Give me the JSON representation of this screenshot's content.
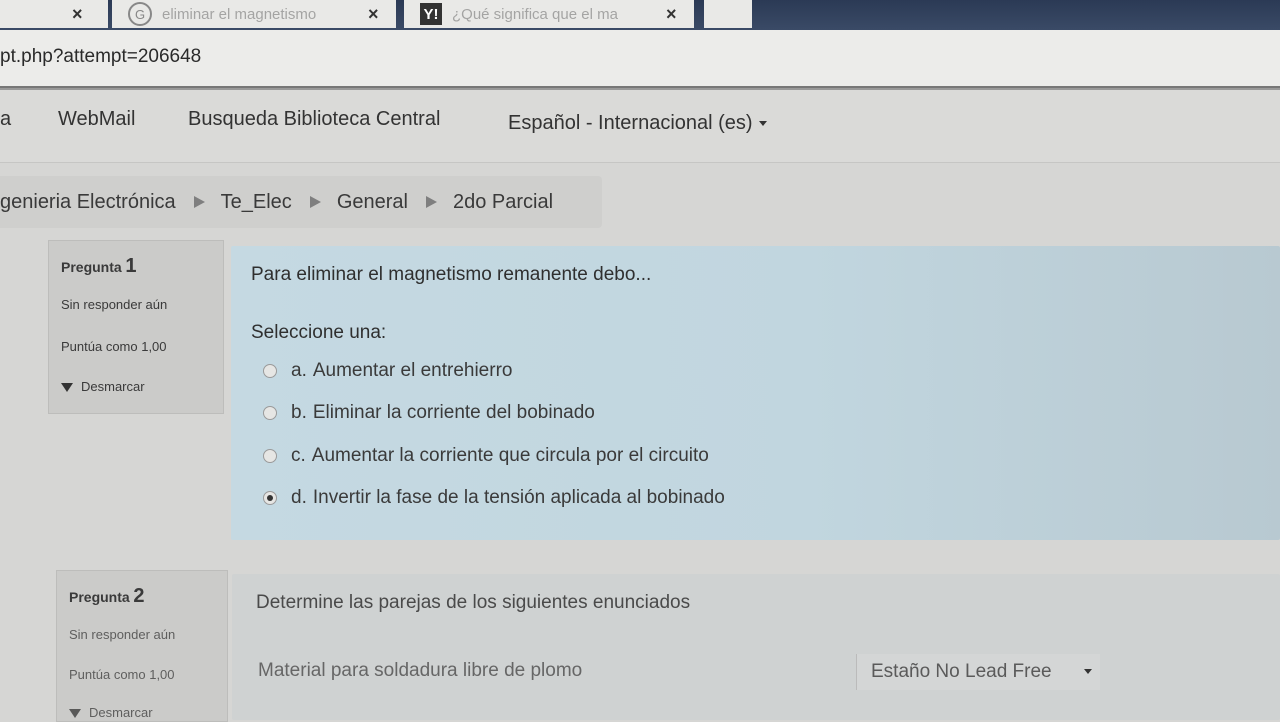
{
  "browser": {
    "tabs": [
      {
        "label": "eliminar el magnetismo",
        "icon": "google-icon"
      },
      {
        "label": "¿Qué significa que el ma",
        "icon": "yahoo-icon"
      }
    ],
    "close_glyph": "×",
    "url": "pt.php?attempt=206648"
  },
  "nav": {
    "items": [
      "a",
      "WebMail",
      "Busqueda Biblioteca Central"
    ],
    "language": "Español - Internacional (es)"
  },
  "breadcrumb": [
    "genieria Electrónica",
    "Te_Elec",
    "General",
    "2do Parcial"
  ],
  "questions": [
    {
      "label": "Pregunta",
      "number": "1",
      "status": "Sin responder aún",
      "score": "Puntúa como 1,00",
      "flag": "Desmarcar",
      "text": "Para eliminar el magnetismo remanente debo...",
      "prompt": "Seleccione una:",
      "options": [
        {
          "letter": "a.",
          "text": "Aumentar el entrehierro",
          "selected": false
        },
        {
          "letter": "b.",
          "text": "Eliminar la corriente del bobinado",
          "selected": false
        },
        {
          "letter": "c.",
          "text": "Aumentar la corriente que circula por el circuito",
          "selected": false
        },
        {
          "letter": "d.",
          "text": "Invertir la fase de la tensión aplicada al bobinado",
          "selected": true
        }
      ]
    },
    {
      "label": "Pregunta",
      "number": "2",
      "status": "Sin responder aún",
      "score": "Puntúa como 1,00",
      "flag": "Desmarcar",
      "text": "Determine las parejas de los siguientes enunciados",
      "match_label": "Material para soldadura libre de plomo",
      "match_value": "Estaño No Lead Free"
    }
  ]
}
